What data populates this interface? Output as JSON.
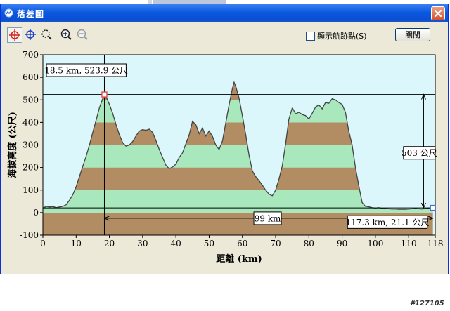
{
  "window": {
    "title": "落差圖",
    "close_label": "關閉",
    "show_waypoints_label": "顯示航跡點(S)",
    "show_waypoints_checked": false
  },
  "toolbar": {
    "tools": [
      {
        "name": "crosshair-red-tool",
        "active": true
      },
      {
        "name": "crosshair-blue-tool",
        "active": false
      },
      {
        "name": "zoom-select-tool",
        "active": false
      },
      {
        "name": "zoom-in-tool",
        "active": false
      },
      {
        "name": "zoom-out-tool",
        "active": false
      }
    ]
  },
  "chart_data": {
    "type": "area",
    "xlabel": "距離 (km)",
    "ylabel": "海拔高度 (公尺)",
    "xlim": [
      0,
      118
    ],
    "ylim": [
      -100,
      700
    ],
    "x_ticks": [
      0,
      10,
      20,
      30,
      40,
      50,
      60,
      70,
      80,
      90,
      100,
      110,
      118
    ],
    "y_ticks": [
      -100,
      0,
      100,
      200,
      300,
      400,
      500,
      600,
      700
    ],
    "band_colors": [
      "#b28c63",
      "#a8e8bc"
    ],
    "background": "#dbf7fc",
    "line_color": "#444444",
    "points": [
      [
        0,
        20
      ],
      [
        1,
        28
      ],
      [
        2,
        25
      ],
      [
        3,
        27
      ],
      [
        4,
        22
      ],
      [
        5,
        25
      ],
      [
        6,
        28
      ],
      [
        7,
        35
      ],
      [
        8,
        55
      ],
      [
        9,
        80
      ],
      [
        10,
        115
      ],
      [
        11,
        160
      ],
      [
        12,
        205
      ],
      [
        13,
        250
      ],
      [
        14,
        300
      ],
      [
        15,
        355
      ],
      [
        16,
        410
      ],
      [
        17,
        465
      ],
      [
        18,
        505
      ],
      [
        18.5,
        524
      ],
      [
        19,
        515
      ],
      [
        20,
        480
      ],
      [
        21,
        440
      ],
      [
        22,
        390
      ],
      [
        23,
        345
      ],
      [
        24,
        310
      ],
      [
        25,
        295
      ],
      [
        26,
        300
      ],
      [
        27,
        315
      ],
      [
        28,
        340
      ],
      [
        29,
        362
      ],
      [
        30,
        368
      ],
      [
        31,
        365
      ],
      [
        32,
        370
      ],
      [
        33,
        355
      ],
      [
        34,
        320
      ],
      [
        35,
        280
      ],
      [
        36,
        245
      ],
      [
        37,
        210
      ],
      [
        38,
        195
      ],
      [
        39,
        202
      ],
      [
        40,
        215
      ],
      [
        41,
        245
      ],
      [
        42,
        265
      ],
      [
        43,
        305
      ],
      [
        44,
        345
      ],
      [
        45,
        405
      ],
      [
        46,
        390
      ],
      [
        47,
        350
      ],
      [
        48,
        375
      ],
      [
        49,
        340
      ],
      [
        50,
        362
      ],
      [
        51,
        338
      ],
      [
        52,
        300
      ],
      [
        53,
        280
      ],
      [
        54,
        318
      ],
      [
        55,
        398
      ],
      [
        56,
        478
      ],
      [
        57,
        550
      ],
      [
        57.5,
        578
      ],
      [
        58,
        560
      ],
      [
        59,
        508
      ],
      [
        60,
        430
      ],
      [
        61,
        345
      ],
      [
        62,
        255
      ],
      [
        63,
        185
      ],
      [
        64,
        160
      ],
      [
        65,
        142
      ],
      [
        66,
        122
      ],
      [
        67,
        100
      ],
      [
        68,
        82
      ],
      [
        69,
        75
      ],
      [
        70,
        100
      ],
      [
        71,
        148
      ],
      [
        72,
        208
      ],
      [
        73,
        305
      ],
      [
        74,
        415
      ],
      [
        75,
        465
      ],
      [
        76,
        438
      ],
      [
        77,
        445
      ],
      [
        78,
        435
      ],
      [
        79,
        430
      ],
      [
        80,
        415
      ],
      [
        81,
        440
      ],
      [
        82,
        468
      ],
      [
        83,
        478
      ],
      [
        84,
        460
      ],
      [
        85,
        488
      ],
      [
        86,
        485
      ],
      [
        87,
        505
      ],
      [
        88,
        500
      ],
      [
        89,
        488
      ],
      [
        90,
        480
      ],
      [
        91,
        445
      ],
      [
        92,
        360
      ],
      [
        93,
        300
      ],
      [
        94,
        200
      ],
      [
        95,
        120
      ],
      [
        96,
        45
      ],
      [
        97,
        28
      ],
      [
        98,
        26
      ],
      [
        99,
        22
      ],
      [
        100,
        20
      ],
      [
        101,
        22
      ],
      [
        102,
        19
      ],
      [
        103,
        18
      ],
      [
        104,
        17
      ],
      [
        105,
        16
      ],
      [
        106,
        16
      ],
      [
        107,
        15
      ],
      [
        108,
        15
      ],
      [
        109,
        15
      ],
      [
        110,
        16
      ],
      [
        111,
        17
      ],
      [
        112,
        18
      ],
      [
        113,
        17
      ],
      [
        114,
        16
      ],
      [
        115,
        18
      ],
      [
        116,
        20
      ],
      [
        117,
        22
      ],
      [
        117.3,
        21
      ]
    ],
    "markers": [
      {
        "x": 18.5,
        "y": 523.9,
        "label": "18.5 km, 523.9 公尺",
        "color": "#e24b4b"
      },
      {
        "x": 117.3,
        "y": 21.1,
        "label": "117.3 km, 21.1 公尺",
        "color": "#3d6fd6"
      }
    ],
    "annotations": {
      "distance_label": "99 km",
      "elevation_diff_label": "503 公尺"
    }
  },
  "footer": {
    "image_id": "#127105"
  }
}
